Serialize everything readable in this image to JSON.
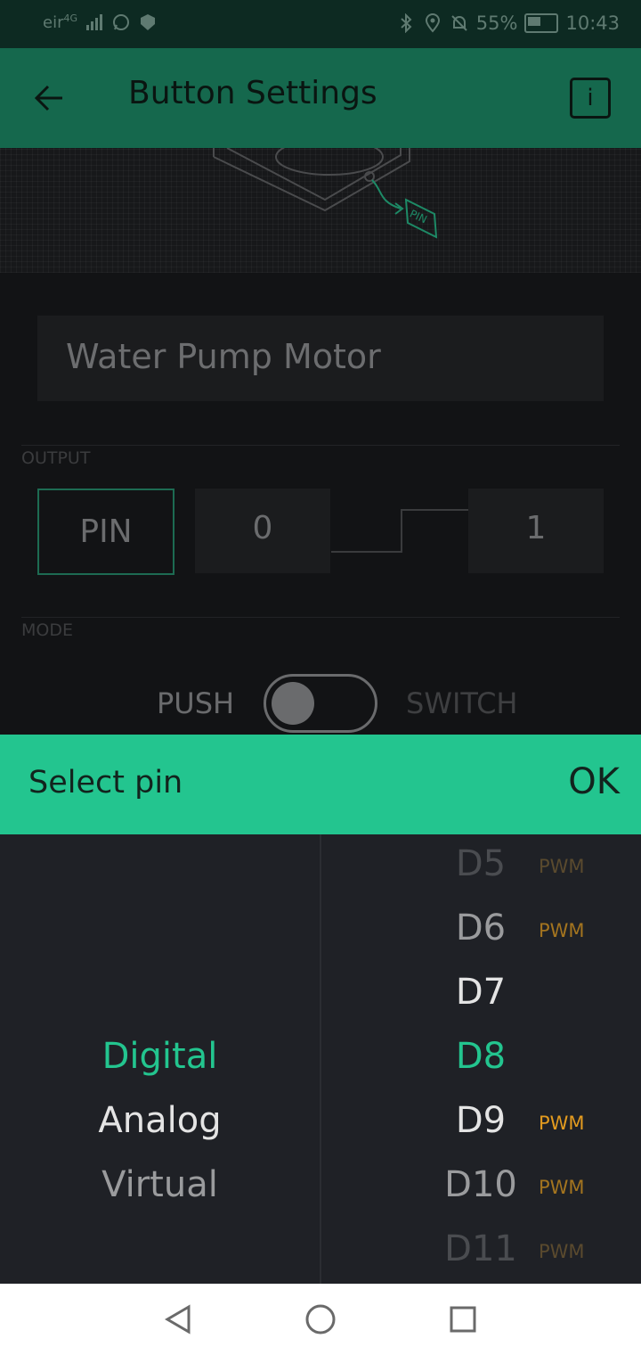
{
  "status_bar": {
    "carrier": "eir",
    "network": "4G",
    "battery": "55%",
    "time": "10:43",
    "icons": [
      "signal-icon",
      "whatsapp-icon",
      "shield-icon",
      "bluetooth-icon",
      "location-icon",
      "mute-icon",
      "battery-icon"
    ]
  },
  "app_bar": {
    "title": "Button Settings",
    "info_label": "i"
  },
  "hero": {
    "pin_tag": "PIN"
  },
  "name_field": {
    "value": "Water Pump Motor"
  },
  "output": {
    "section_label": "OUTPUT",
    "pin_label": "PIN",
    "low_value": "0",
    "high_value": "1"
  },
  "mode": {
    "section_label": "MODE",
    "push_label": "PUSH",
    "switch_label": "SWITCH",
    "switch_on": false
  },
  "picker": {
    "title": "Select pin",
    "ok_label": "OK",
    "types": [
      {
        "label": "Digital",
        "selected": true
      },
      {
        "label": "Analog",
        "selected": false
      },
      {
        "label": "Virtual",
        "selected": false
      }
    ],
    "pins": [
      {
        "label": "D5",
        "tag": "PWM"
      },
      {
        "label": "D6",
        "tag": "PWM"
      },
      {
        "label": "D7",
        "tag": ""
      },
      {
        "label": "D8",
        "tag": "",
        "selected": true
      },
      {
        "label": "D9",
        "tag": "PWM"
      },
      {
        "label": "D10",
        "tag": "PWM"
      },
      {
        "label": "D11",
        "tag": "PWM"
      }
    ],
    "colors": {
      "accent": "#23c58f",
      "pwm": "#e39b1f"
    }
  },
  "nav_bar": {
    "buttons": [
      "back-triangle-icon",
      "home-circle-icon",
      "recents-square-icon"
    ]
  }
}
